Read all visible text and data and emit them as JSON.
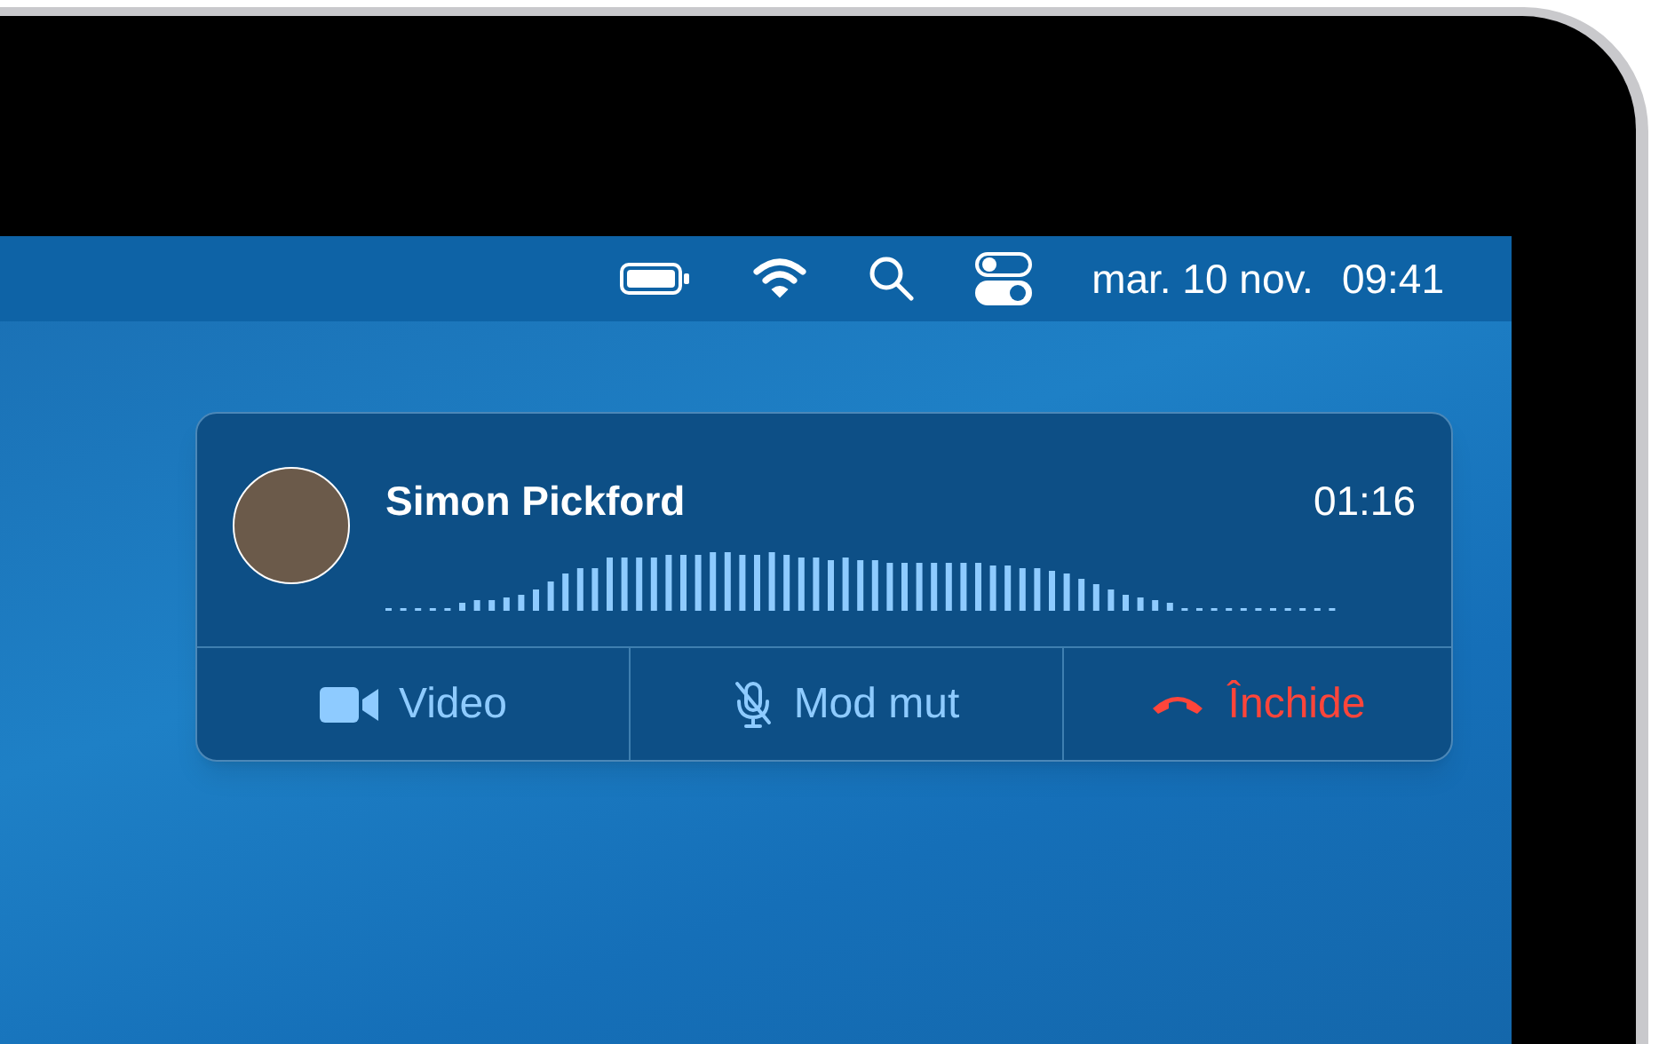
{
  "menu_bar": {
    "date": "mar. 10 nov.",
    "time": "09:41"
  },
  "call": {
    "caller": "Simon Pickford",
    "duration": "01:16",
    "buttons": [
      {
        "kind": "video",
        "label": "Video"
      },
      {
        "kind": "mute",
        "label": "Mod mut"
      },
      {
        "kind": "hangup",
        "label": "Închide"
      }
    ]
  }
}
